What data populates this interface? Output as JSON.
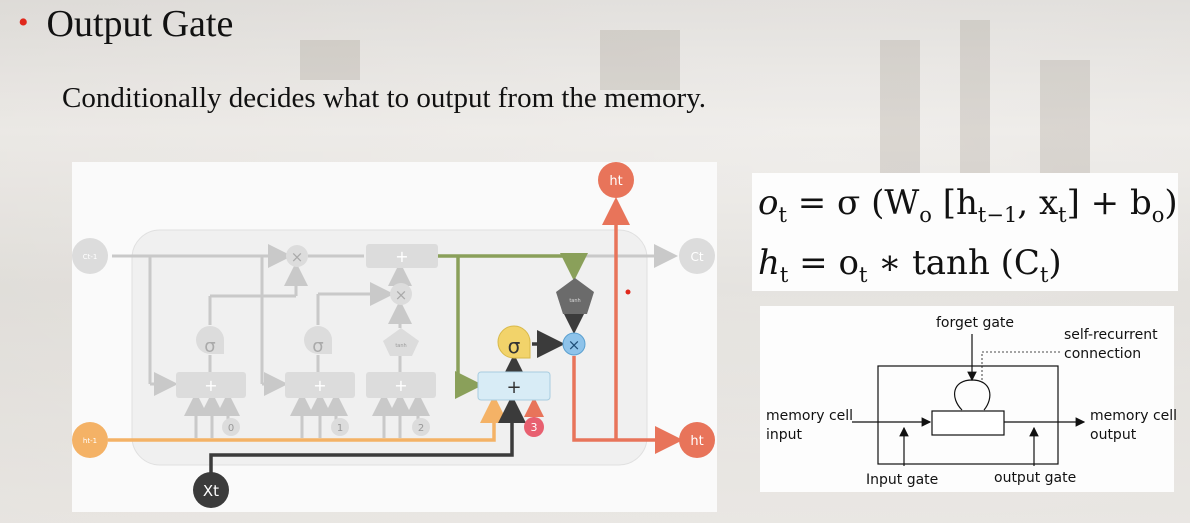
{
  "slide": {
    "bullet": "•",
    "title": "Output Gate",
    "subtitle": "Conditionally decides what to output from the memory."
  },
  "lstm_diagram": {
    "c_prev": "Ct-1",
    "c_t": "Ct",
    "h_prev": "ht-1",
    "h_t_top": "ht",
    "h_t_right": "ht",
    "x_t": "Xt",
    "sigma": "σ",
    "tanh": "tanh",
    "plus": "+",
    "times": "×",
    "step_0": "0",
    "step_1": "1",
    "step_2": "2",
    "step_3": "3",
    "colors": {
      "cell_line": "#8aa05a",
      "hidden_in": "#f4b266",
      "output": "#e8745a",
      "x_line": "#3b3b3b",
      "sigma_gate": "#f2d36a",
      "multiply": "#8ec3ea",
      "adder": "#d8ecf6",
      "faded": "#c9c9c9"
    }
  },
  "equations": {
    "eq1": {
      "lhs": "o",
      "lhs_sub": "t",
      "body": "= σ (W",
      "w_sub": "o",
      "bracket": "[h",
      "h_sub": "t−1",
      "x_part": ", x",
      "x_sub": "t",
      "close": "] + b",
      "b_sub": "o",
      "end": ")"
    },
    "eq2": {
      "lhs": "h",
      "lhs_sub": "t",
      "eq": "= o",
      "o_sub": "t",
      "rest": "∗ tanh (C",
      "c_sub": "t",
      "end": ")"
    }
  },
  "memory_cell_diagram": {
    "forget_gate": "forget gate",
    "self_recurrent_1": "self-recurrent",
    "self_recurrent_2": "connection",
    "input_1": "memory cell",
    "input_2": "input",
    "output_1": "memory cell",
    "output_2": "output",
    "input_gate": "Input gate",
    "output_gate": "output gate"
  }
}
